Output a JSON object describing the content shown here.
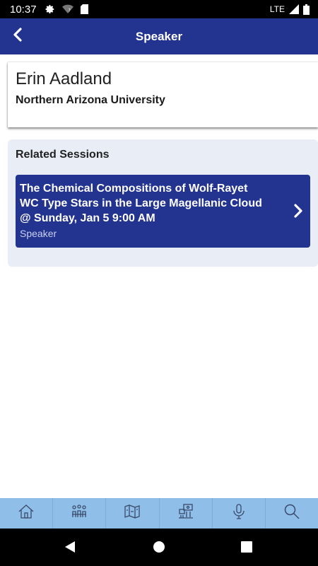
{
  "status_bar": {
    "time": "10:37",
    "network": "LTE",
    "icons": [
      "gear-icon",
      "wifi-question-icon",
      "sd-card-icon",
      "signal-icon",
      "battery-icon"
    ]
  },
  "header": {
    "title": "Speaker",
    "back_icon": "chevron-left-icon",
    "background": "#233390"
  },
  "speaker": {
    "name": "Erin Aadland",
    "organization": "Northern Arizona University"
  },
  "related_sessions": {
    "heading": "Related Sessions",
    "sessions": [
      {
        "title_lines": [
          "The Chemical Compositions of Wolf-Rayet",
          "WC Type Stars in the Large Magellanic Cloud",
          "@ Sunday, Jan 5 9:00 AM"
        ],
        "role": "Speaker",
        "icon": "chevron-right-icon"
      }
    ]
  },
  "tab_bar": {
    "background": "#8fbfe8",
    "tabs": [
      "home-icon",
      "people-icon",
      "map-icon",
      "exhibitors-icon",
      "microphone-icon",
      "search-icon"
    ]
  },
  "nav_bar": {
    "buttons": [
      "back-triangle-icon",
      "home-circle-icon",
      "recents-square-icon"
    ]
  }
}
